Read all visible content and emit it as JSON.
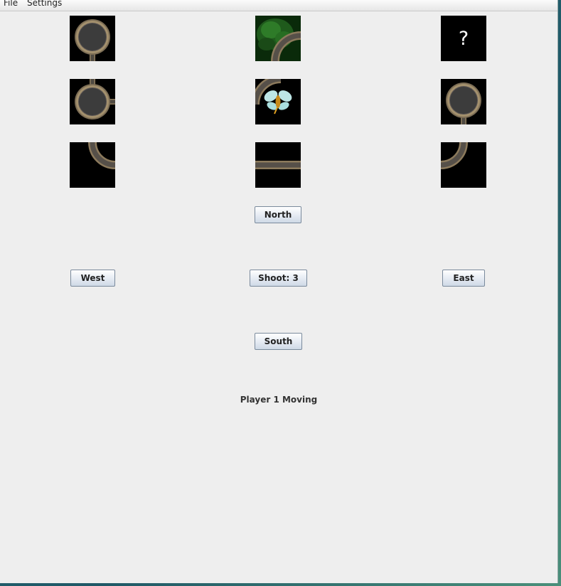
{
  "menu": {
    "file_label": "File",
    "settings_label": "Settings"
  },
  "tiles": {
    "r0c0": "cave-room",
    "r0c1": "cave-with-green-slime",
    "r0c2": "unknown-cave",
    "r0c2_text": "?",
    "r1c0": "cave-room-with-east-tunnel",
    "r1c1": "cave-with-bat",
    "r1c2": "cave-room",
    "r2c0": "curved-tunnel",
    "r2c1": "straight-tunnel",
    "r2c2": "curved-tunnel"
  },
  "controls": {
    "north_label": "North",
    "west_label": "West",
    "shoot_label": "Shoot: 3",
    "east_label": "East",
    "south_label": "South"
  },
  "status": {
    "text": "Player 1  Moving"
  }
}
